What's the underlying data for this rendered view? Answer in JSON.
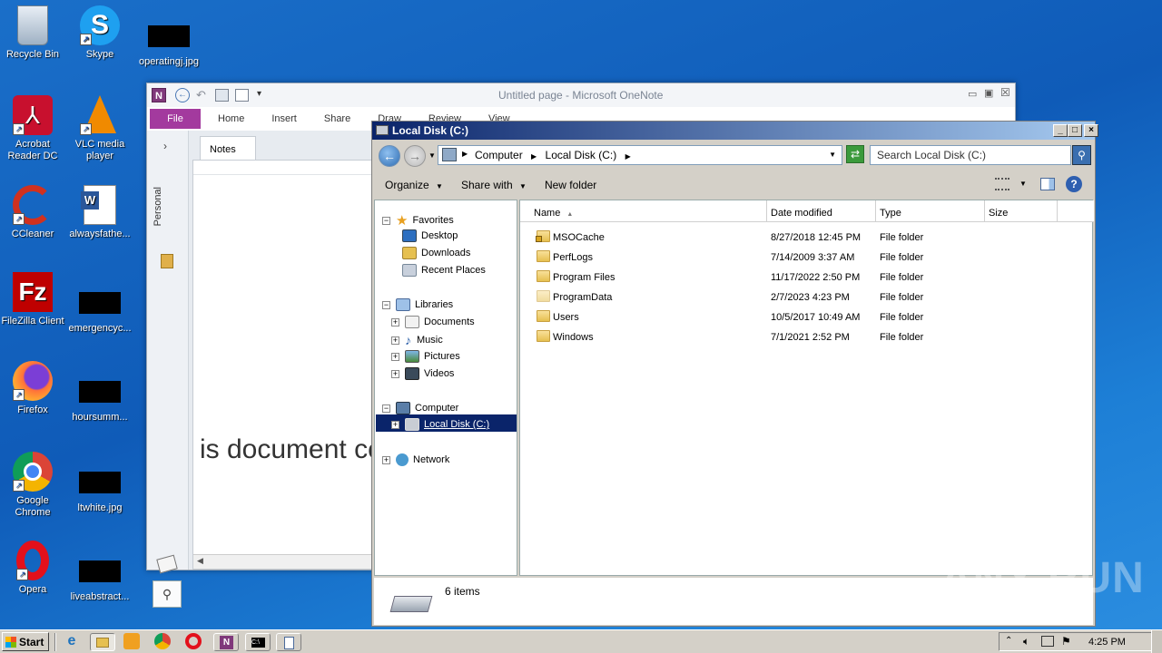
{
  "desktop": {
    "icons": [
      {
        "label": "Recycle Bin"
      },
      {
        "label": "Skype"
      },
      {
        "label": "operatingj.jpg"
      },
      {
        "label": "Acrobat Reader DC"
      },
      {
        "label": "VLC media player"
      },
      {
        "label": "CCleaner"
      },
      {
        "label": "alwaysfathe..."
      },
      {
        "label": "FileZilla Client"
      },
      {
        "label": "emergencyc..."
      },
      {
        "label": "Firefox"
      },
      {
        "label": "hoursumm..."
      },
      {
        "label": "Google Chrome"
      },
      {
        "label": "ltwhite.jpg"
      },
      {
        "label": "Opera"
      },
      {
        "label": "liveabstract..."
      }
    ]
  },
  "onenote": {
    "title": "Untitled page  -  Microsoft OneNote",
    "tabs": [
      "File",
      "Home",
      "Insert",
      "Share",
      "Draw",
      "Review",
      "View"
    ],
    "notebook_label": "Personal",
    "section_tab": "Notes",
    "page_text": "is document co"
  },
  "explorer": {
    "title": "Local Disk (C:)",
    "breadcrumb": [
      "Computer",
      "Local Disk (C:)"
    ],
    "search_placeholder": "Search Local Disk (C:)",
    "toolbar": {
      "organize": "Organize",
      "share_with": "Share with",
      "new_folder": "New folder"
    },
    "nav": {
      "favorites": "Favorites",
      "desktop": "Desktop",
      "downloads": "Downloads",
      "recent": "Recent Places",
      "libraries": "Libraries",
      "documents": "Documents",
      "music": "Music",
      "pictures": "Pictures",
      "videos": "Videos",
      "computer": "Computer",
      "local_disk": "Local Disk (C:)",
      "network": "Network"
    },
    "columns": [
      "Name",
      "Date modified",
      "Type",
      "Size"
    ],
    "files": [
      {
        "name": "MSOCache",
        "date": "8/27/2018 12:45 PM",
        "type": "File folder"
      },
      {
        "name": "PerfLogs",
        "date": "7/14/2009 3:37 AM",
        "type": "File folder"
      },
      {
        "name": "Program Files",
        "date": "11/17/2022 2:50 PM",
        "type": "File folder"
      },
      {
        "name": "ProgramData",
        "date": "2/7/2023 4:23 PM",
        "type": "File folder"
      },
      {
        "name": "Users",
        "date": "10/5/2017 10:49 AM",
        "type": "File folder"
      },
      {
        "name": "Windows",
        "date": "7/1/2021 2:52 PM",
        "type": "File folder"
      }
    ],
    "status": "6 items"
  },
  "taskbar": {
    "start": "Start",
    "time": "4:25 PM"
  },
  "watermark": "ANY RUN"
}
